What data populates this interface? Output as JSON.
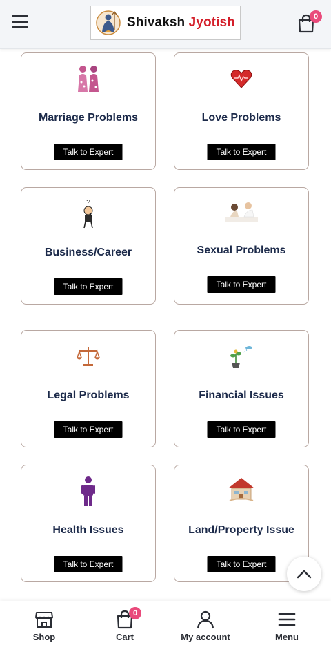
{
  "header": {
    "brand_word1": "Shivaksh",
    "brand_word2": "Jyotish",
    "cart_count": "0",
    "accent": "#d41f2a",
    "badge_color": "#e94a7b"
  },
  "cards": [
    {
      "title": "Marriage Problems",
      "cta": "Talk to Expert",
      "icon": "couple-icon"
    },
    {
      "title": "Love Problems",
      "cta": "Talk to Expert",
      "icon": "heart-icon"
    },
    {
      "title": "Business/Career",
      "cta": "Talk to Expert",
      "icon": "thinking-person-icon"
    },
    {
      "title": "Sexual Problems",
      "cta": "Talk to Expert",
      "icon": "couple-bed-icon"
    },
    {
      "title": "Legal Problems",
      "cta": "Talk to Expert",
      "icon": "scales-icon"
    },
    {
      "title": "Financial Issues",
      "cta": "Talk to Expert",
      "icon": "money-plant-icon"
    },
    {
      "title": "Health Issues",
      "cta": "Talk to Expert",
      "icon": "person-icon"
    },
    {
      "title": "Land/Property Issue",
      "cta": "Talk to Expert",
      "icon": "house-icon"
    }
  ],
  "bottom_nav": {
    "shop": "Shop",
    "cart": "Cart",
    "cart_count": "0",
    "account": "My account",
    "menu": "Menu"
  }
}
